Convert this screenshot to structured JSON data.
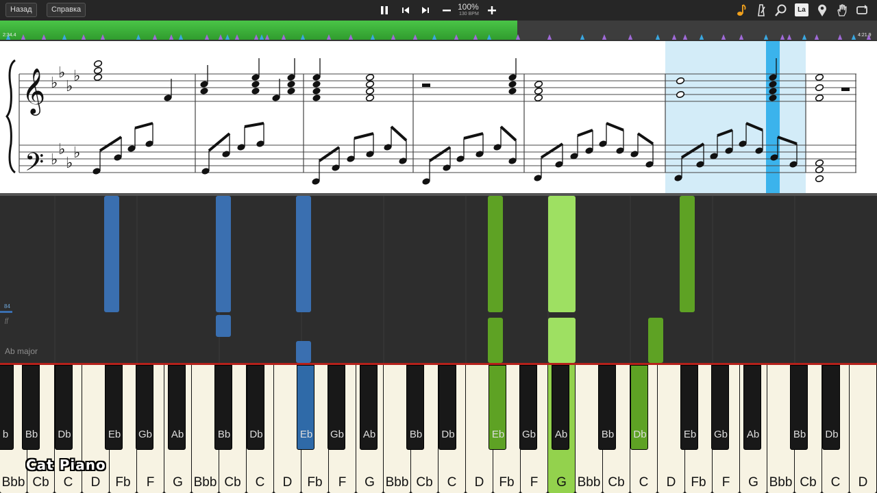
{
  "toolbar": {
    "back_label": "Назад",
    "help_label": "Справка",
    "zoom": "100%",
    "tempo": "130 BPM",
    "note_name_badge": "La",
    "icons": [
      "pause-icon",
      "previous-icon",
      "next-icon",
      "minus-icon",
      "plus-icon",
      "note-icon",
      "metronome-icon",
      "search-icon",
      "note-name-icon",
      "location-pin-icon",
      "hand-icon",
      "loop-icon"
    ]
  },
  "progress": {
    "elapsed": "2:34.4",
    "total": "4:21.9",
    "fraction": 0.59
  },
  "sheet": {
    "key_signature": "Ab major",
    "flats": 4
  },
  "falling": {
    "key_label": "Ab major",
    "velocity_value": "84",
    "velocity_dynamic": "ff"
  },
  "colors": {
    "left_hand": "#3a6fb0",
    "right_hand": "#5ea224",
    "right_hand_light": "#9ee062",
    "progress": "#3fb63c"
  },
  "keyboard": {
    "white_keys": [
      "Bbb",
      "Cb",
      "C",
      "D",
      "Fb",
      "F",
      "G",
      "Bbb",
      "Cb",
      "C",
      "D",
      "Fb",
      "F",
      "G",
      "Bbb",
      "Cb",
      "C",
      "D",
      "Fb",
      "F",
      "G",
      "Bbb",
      "Cb",
      "C",
      "D",
      "Fb",
      "F",
      "G",
      "Bbb",
      "Cb",
      "C",
      "D"
    ],
    "black_keys": [
      {
        "label": "b",
        "state": ""
      },
      {
        "label": "Bb",
        "state": ""
      },
      {
        "label": "Db",
        "state": ""
      },
      {
        "label": "Eb",
        "state": ""
      },
      {
        "label": "Gb",
        "state": ""
      },
      {
        "label": "Ab",
        "state": ""
      },
      {
        "label": "Bb",
        "state": ""
      },
      {
        "label": "Db",
        "state": ""
      },
      {
        "label": "Eb",
        "state": "blue"
      },
      {
        "label": "Gb",
        "state": ""
      },
      {
        "label": "Ab",
        "state": ""
      },
      {
        "label": "Bb",
        "state": ""
      },
      {
        "label": "Db",
        "state": ""
      },
      {
        "label": "Eb",
        "state": "green"
      },
      {
        "label": "Gb",
        "state": ""
      },
      {
        "label": "Ab",
        "state": ""
      },
      {
        "label": "Bb",
        "state": ""
      },
      {
        "label": "Db",
        "state": "green"
      },
      {
        "label": "Eb",
        "state": ""
      },
      {
        "label": "Gb",
        "state": ""
      },
      {
        "label": "Ab",
        "state": ""
      },
      {
        "label": "Bb",
        "state": ""
      },
      {
        "label": "Db",
        "state": ""
      }
    ],
    "pressed_white": [
      {
        "index": 20,
        "state": "green"
      }
    ]
  },
  "logo": "Cat Piano"
}
